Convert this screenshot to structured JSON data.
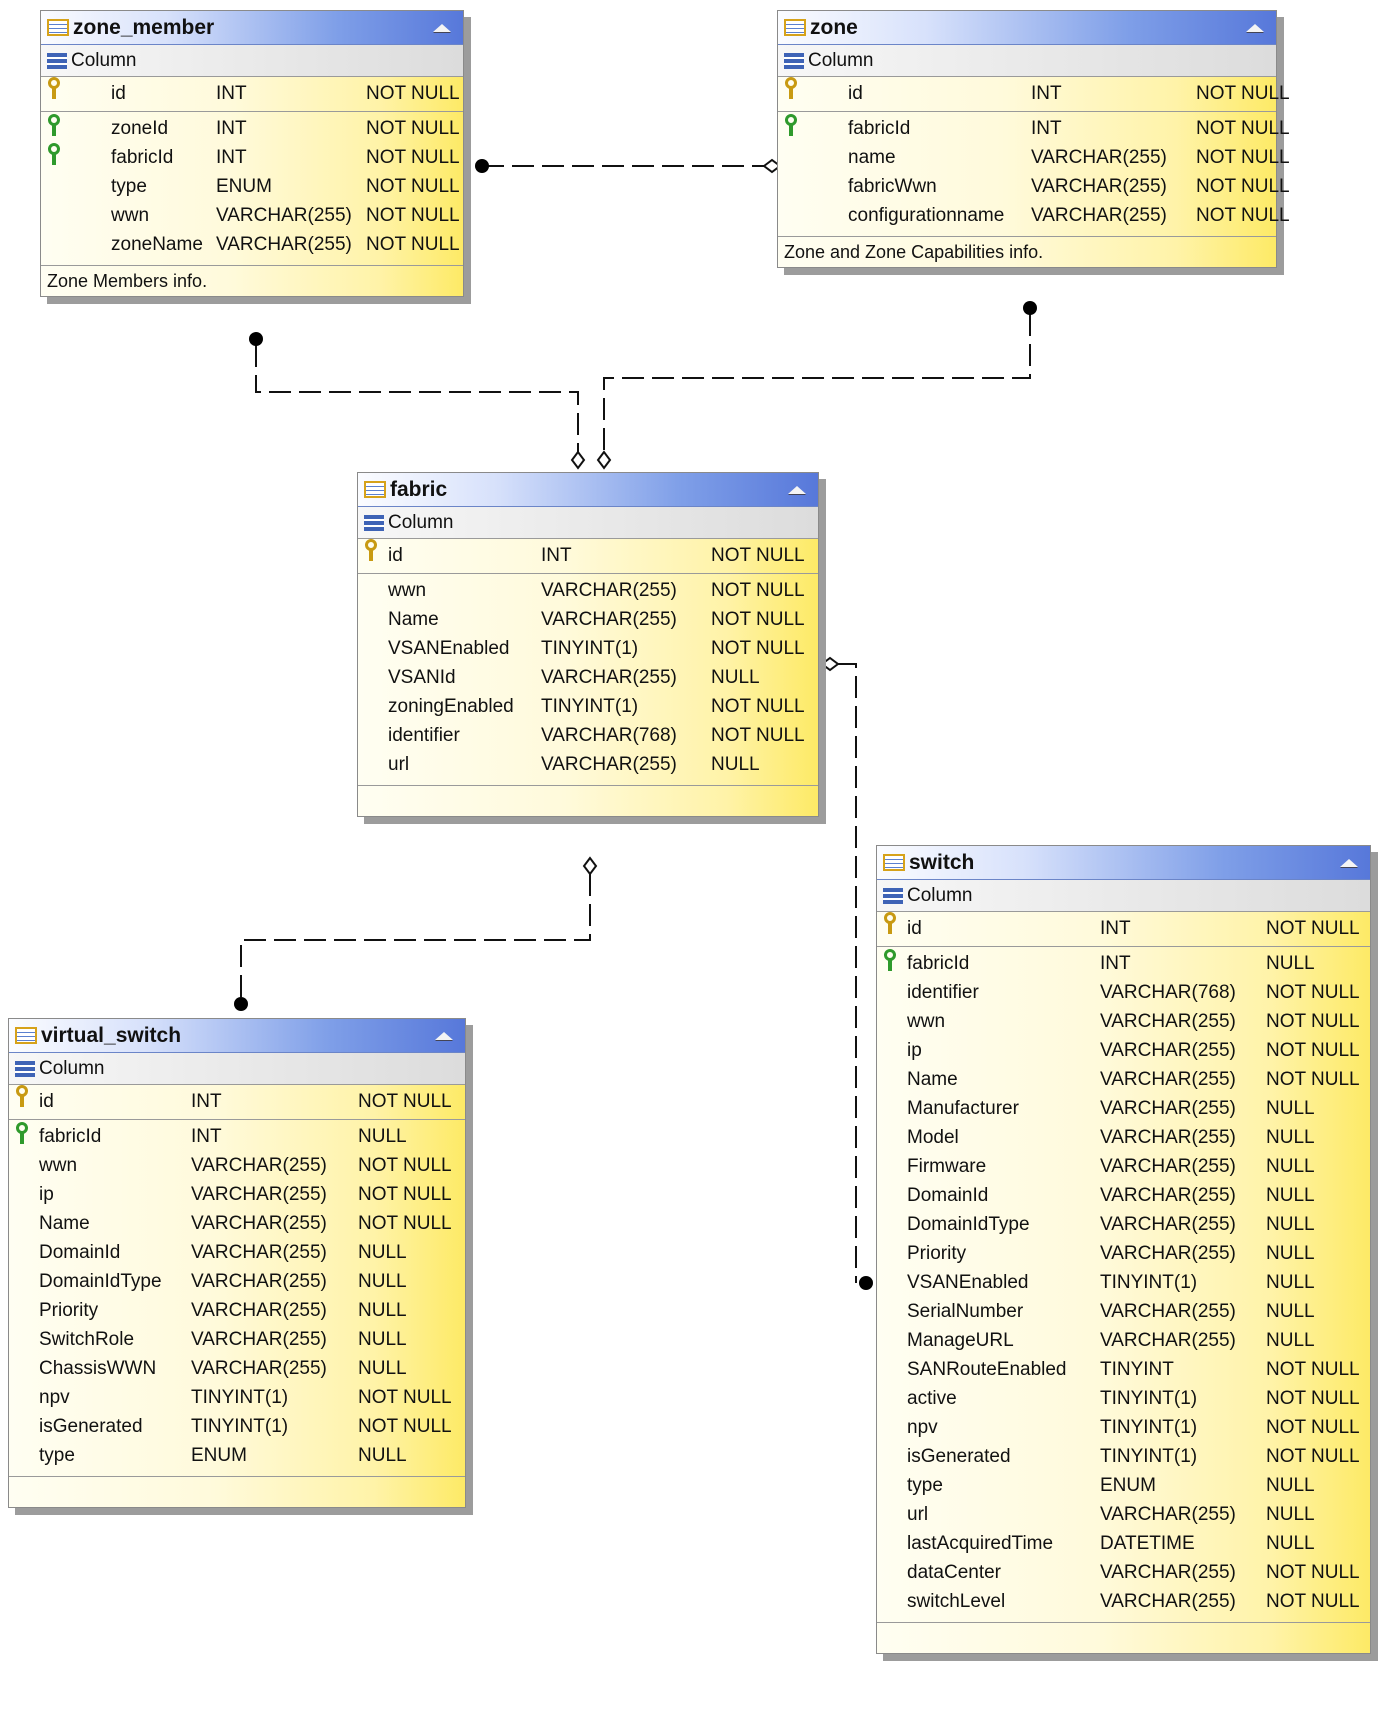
{
  "tables": {
    "zone_member": {
      "name": "zone_member",
      "column_header": "Column",
      "pk": {
        "name": "id",
        "type": "INT",
        "null": "NOT NULL"
      },
      "columns": [
        {
          "name": "zoneId",
          "type": "INT",
          "null": "NOT NULL",
          "fk": true
        },
        {
          "name": "fabricId",
          "type": "INT",
          "null": "NOT NULL",
          "fk": true
        },
        {
          "name": "type",
          "type": "ENUM",
          "null": "NOT NULL"
        },
        {
          "name": "wwn",
          "type": "VARCHAR(255)",
          "null": "NOT NULL"
        },
        {
          "name": "zoneName",
          "type": "VARCHAR(255)",
          "null": "NOT NULL"
        }
      ],
      "comment": "Zone Members info."
    },
    "zone": {
      "name": "zone",
      "column_header": "Column",
      "pk": {
        "name": "id",
        "type": "INT",
        "null": "NOT NULL"
      },
      "columns": [
        {
          "name": "fabricId",
          "type": "INT",
          "null": "NOT NULL",
          "fk": true
        },
        {
          "name": "name",
          "type": "VARCHAR(255)",
          "null": "NOT NULL"
        },
        {
          "name": "fabricWwn",
          "type": "VARCHAR(255)",
          "null": "NOT NULL"
        },
        {
          "name": "configurationname",
          "type": "VARCHAR(255)",
          "null": "NOT NULL"
        }
      ],
      "comment": "Zone and Zone Capabilities info."
    },
    "fabric": {
      "name": "fabric",
      "column_header": "Column",
      "pk": {
        "name": "id",
        "type": "INT",
        "null": "NOT NULL"
      },
      "columns": [
        {
          "name": "wwn",
          "type": "VARCHAR(255)",
          "null": "NOT NULL"
        },
        {
          "name": "Name",
          "type": "VARCHAR(255)",
          "null": "NOT NULL"
        },
        {
          "name": "VSANEnabled",
          "type": "TINYINT(1)",
          "null": "NOT NULL"
        },
        {
          "name": "VSANId",
          "type": "VARCHAR(255)",
          "null": "NULL"
        },
        {
          "name": "zoningEnabled",
          "type": "TINYINT(1)",
          "null": "NOT NULL"
        },
        {
          "name": "identifier",
          "type": "VARCHAR(768)",
          "null": "NOT NULL"
        },
        {
          "name": "url",
          "type": "VARCHAR(255)",
          "null": "NULL"
        }
      ],
      "comment": ""
    },
    "virtual_switch": {
      "name": "virtual_switch",
      "column_header": "Column",
      "pk": {
        "name": "id",
        "type": "INT",
        "null": "NOT NULL"
      },
      "columns": [
        {
          "name": "fabricId",
          "type": "INT",
          "null": "NULL",
          "fk": true
        },
        {
          "name": "wwn",
          "type": "VARCHAR(255)",
          "null": "NOT NULL"
        },
        {
          "name": "ip",
          "type": "VARCHAR(255)",
          "null": "NOT NULL"
        },
        {
          "name": "Name",
          "type": "VARCHAR(255)",
          "null": "NOT NULL"
        },
        {
          "name": "DomainId",
          "type": "VARCHAR(255)",
          "null": "NULL"
        },
        {
          "name": "DomainIdType",
          "type": "VARCHAR(255)",
          "null": "NULL"
        },
        {
          "name": "Priority",
          "type": "VARCHAR(255)",
          "null": "NULL"
        },
        {
          "name": "SwitchRole",
          "type": "VARCHAR(255)",
          "null": "NULL"
        },
        {
          "name": "ChassisWWN",
          "type": "VARCHAR(255)",
          "null": "NULL"
        },
        {
          "name": "npv",
          "type": "TINYINT(1)",
          "null": "NOT NULL"
        },
        {
          "name": "isGenerated",
          "type": "TINYINT(1)",
          "null": "NOT NULL"
        },
        {
          "name": "type",
          "type": "ENUM",
          "null": "NULL"
        }
      ],
      "comment": ""
    },
    "switch": {
      "name": "switch",
      "column_header": "Column",
      "pk": {
        "name": "id",
        "type": "INT",
        "null": "NOT NULL"
      },
      "columns": [
        {
          "name": "fabricId",
          "type": "INT",
          "null": "NULL",
          "fk": true
        },
        {
          "name": "identifier",
          "type": "VARCHAR(768)",
          "null": "NOT NULL"
        },
        {
          "name": "wwn",
          "type": "VARCHAR(255)",
          "null": "NOT NULL"
        },
        {
          "name": "ip",
          "type": "VARCHAR(255)",
          "null": "NOT NULL"
        },
        {
          "name": "Name",
          "type": "VARCHAR(255)",
          "null": "NOT NULL"
        },
        {
          "name": "Manufacturer",
          "type": "VARCHAR(255)",
          "null": "NULL"
        },
        {
          "name": "Model",
          "type": "VARCHAR(255)",
          "null": "NULL"
        },
        {
          "name": "Firmware",
          "type": "VARCHAR(255)",
          "null": "NULL"
        },
        {
          "name": "DomainId",
          "type": "VARCHAR(255)",
          "null": "NULL"
        },
        {
          "name": "DomainIdType",
          "type": "VARCHAR(255)",
          "null": "NULL"
        },
        {
          "name": "Priority",
          "type": "VARCHAR(255)",
          "null": "NULL"
        },
        {
          "name": "VSANEnabled",
          "type": "TINYINT(1)",
          "null": "NULL"
        },
        {
          "name": "SerialNumber",
          "type": "VARCHAR(255)",
          "null": "NULL"
        },
        {
          "name": "ManageURL",
          "type": "VARCHAR(255)",
          "null": "NULL"
        },
        {
          "name": "SANRouteEnabled",
          "type": "TINYINT",
          "null": "NOT NULL"
        },
        {
          "name": "active",
          "type": "TINYINT(1)",
          "null": "NOT NULL"
        },
        {
          "name": "npv",
          "type": "TINYINT(1)",
          "null": "NOT NULL"
        },
        {
          "name": "isGenerated",
          "type": "TINYINT(1)",
          "null": "NOT NULL"
        },
        {
          "name": "type",
          "type": "ENUM",
          "null": "NULL"
        },
        {
          "name": "url",
          "type": "VARCHAR(255)",
          "null": "NULL"
        },
        {
          "name": "lastAcquiredTime",
          "type": "DATETIME",
          "null": "NULL"
        },
        {
          "name": "dataCenter",
          "type": "VARCHAR(255)",
          "null": "NOT NULL"
        },
        {
          "name": "switchLevel",
          "type": "VARCHAR(255)",
          "null": "NOT NULL"
        }
      ],
      "comment": ""
    }
  },
  "colors": {
    "header_blue": "#5778da",
    "body_yellow": "#fdea66",
    "pk_key": "#c89a12",
    "fk_key": "#2f9a2c"
  },
  "icons": {
    "table": "table-icon",
    "column": "column-icon",
    "primary_key": "primary-key-icon",
    "foreign_key": "foreign-key-icon",
    "collapse": "collapse-arrow-icon"
  }
}
